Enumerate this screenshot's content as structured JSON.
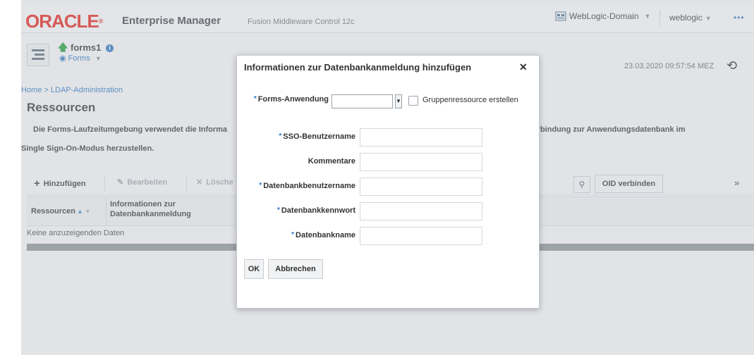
{
  "header": {
    "logo_text": "ORACLE",
    "app_title": "Enterprise Manager",
    "app_subtitle": "Fusion Middleware Control 12c",
    "domain": "WebLogic-Domain",
    "user": "weblogic",
    "more": "•••"
  },
  "target": {
    "name": "forms1",
    "menu": "Forms",
    "timestamp": "23.03.2020 09:57:54 MEZ"
  },
  "breadcrumb": {
    "home": "Home",
    "current": "LDAP-Administration"
  },
  "page": {
    "title": "Ressourcen",
    "description_start": "Die Forms-Laufzeitumgebung verwendet die Informa",
    "description_end": "m die Verbindung zur Anwendungsdatenbank im",
    "description_line2": "Single Sign-On-Modus herzustellen."
  },
  "toolbar": {
    "add": "Hinzufügen",
    "edit": "Bearbeiten",
    "delete": "Lösche",
    "oid_connect": "OID verbinden"
  },
  "table": {
    "col_resources": "Ressourcen",
    "col_info_line1": "Informationen zur",
    "col_info_line2": "Datenbankanmeldung",
    "empty_text": "Keine anzuzeigenden Daten"
  },
  "dialog": {
    "title": "Informationen zur Datenbankanmeldung hinzufügen",
    "forms_app_label": "Forms-Anwendung",
    "forms_app_value": "",
    "group_resource_label": "Gruppenressource erstellen",
    "sso_user_label": "SSO-Benutzername",
    "comments_label": "Kommentare",
    "db_user_label": "Datenbankbenutzername",
    "db_password_label": "Datenbankkennwort",
    "db_name_label": "Datenbankname",
    "ok": "OK",
    "cancel": "Abbrechen"
  }
}
